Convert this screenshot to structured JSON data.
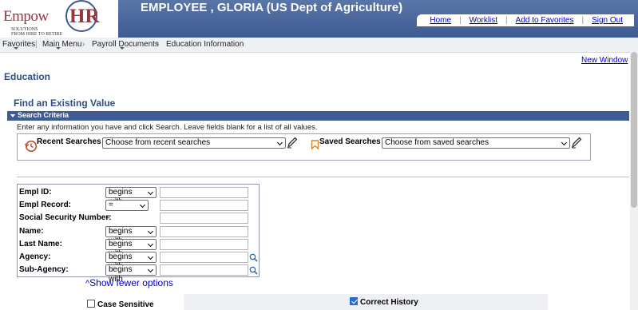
{
  "banner": {
    "logo_text": "EmpowHR",
    "logo_sub": "SOLUTIONS FROM HIRE TO RETIRE",
    "title": "EMPLOYEE , GLORIA (US Dept of Agriculture)",
    "links": [
      "Home",
      "Worklist",
      "Add to Favorites",
      "Sign Out"
    ]
  },
  "nav": {
    "favorites": "Favorites",
    "main_menu": "Main Menu",
    "payroll_docs": "Payroll Documents",
    "current": "Education Information"
  },
  "new_window": "New Window",
  "page_title": "Education",
  "find_title": "Find an Existing Value",
  "search_criteria": "Search Criteria",
  "instructions": "Enter any information you have and click Search. Leave fields blank for a list of all values.",
  "recent": {
    "label": "Recent Searches",
    "value": "Choose from recent searches"
  },
  "saved": {
    "label": "Saved Searches",
    "value": "Choose from saved searches"
  },
  "fields": [
    {
      "label": "Empl ID:",
      "op": "begins with"
    },
    {
      "label": "Empl Record:",
      "op": "="
    },
    {
      "label": "Social Security Number:",
      "op": "="
    },
    {
      "label": "Name:",
      "op": "begins with"
    },
    {
      "label": "Last Name:",
      "op": "begins with"
    },
    {
      "label": "Agency:",
      "op": "begins with"
    },
    {
      "label": "Sub-Agency:",
      "op": "begins with"
    }
  ],
  "show_fewer": "Show fewer options",
  "case_sensitive": "Case Sensitive",
  "correct_history": "Correct History",
  "colors": {
    "banner": "#3d5a92",
    "header_text": "#2d4f86",
    "link": "#0000cc"
  }
}
